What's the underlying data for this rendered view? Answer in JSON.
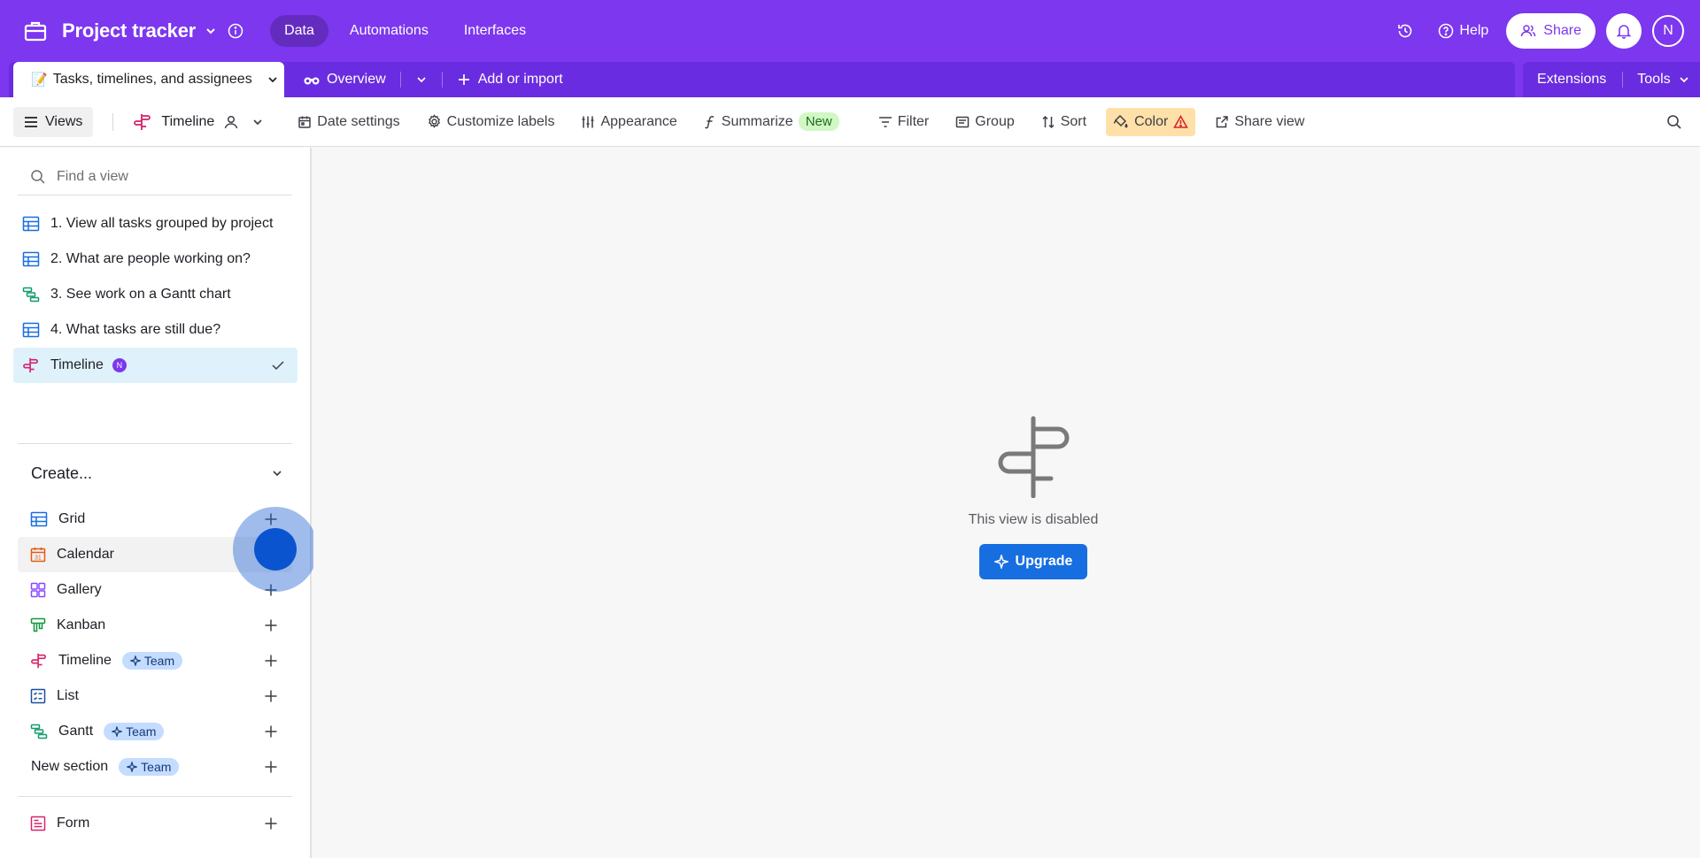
{
  "topbar": {
    "base_title": "Project tracker",
    "nav_tabs": [
      {
        "label": "Data",
        "active": true
      },
      {
        "label": "Automations",
        "active": false
      },
      {
        "label": "Interfaces",
        "active": false
      }
    ],
    "help_label": "Help",
    "share_label": "Share",
    "avatar_initial": "N",
    "brand_color": "#7c37ef"
  },
  "tablebar": {
    "active_table": {
      "emoji": "📝",
      "label": "Tasks, timelines, and assignees"
    },
    "other_table": {
      "label": "Overview"
    },
    "add_label": "Add or import",
    "extensions_label": "Extensions",
    "tools_label": "Tools"
  },
  "viewbar": {
    "views_label": "Views",
    "view_name": "Timeline",
    "date_settings": "Date settings",
    "customize_labels": "Customize labels",
    "appearance": "Appearance",
    "summarize": "Summarize",
    "new_badge": "New",
    "filter": "Filter",
    "group": "Group",
    "sort": "Sort",
    "color": "Color",
    "share_view": "Share view"
  },
  "sidebar": {
    "find_placeholder": "Find a view",
    "views": [
      {
        "label": "1. View all tasks grouped by project",
        "icon": "grid-icon"
      },
      {
        "label": "2. What are people working on?",
        "icon": "grid-icon"
      },
      {
        "label": "3. See work on a Gantt chart",
        "icon": "gantt-icon"
      },
      {
        "label": "4. What tasks are still due?",
        "icon": "grid-icon"
      },
      {
        "label": "Timeline",
        "icon": "timeline-icon",
        "selected": true,
        "owner": "N"
      }
    ],
    "create_label": "Create...",
    "create_items": [
      {
        "label": "Grid",
        "icon": "grid-icon"
      },
      {
        "label": "Calendar",
        "icon": "calendar-icon"
      },
      {
        "label": "Gallery",
        "icon": "gallery-icon"
      },
      {
        "label": "Kanban",
        "icon": "kanban-icon"
      },
      {
        "label": "Timeline",
        "icon": "timeline-icon",
        "badge": "Team"
      },
      {
        "label": "List",
        "icon": "list-icon"
      },
      {
        "label": "Gantt",
        "icon": "gantt-icon",
        "badge": "Team"
      },
      {
        "label": "New section",
        "badge": "Team"
      }
    ],
    "form_item": {
      "label": "Form",
      "icon": "form-icon"
    }
  },
  "main": {
    "disabled_text": "This view is disabled",
    "upgrade_label": "Upgrade"
  }
}
